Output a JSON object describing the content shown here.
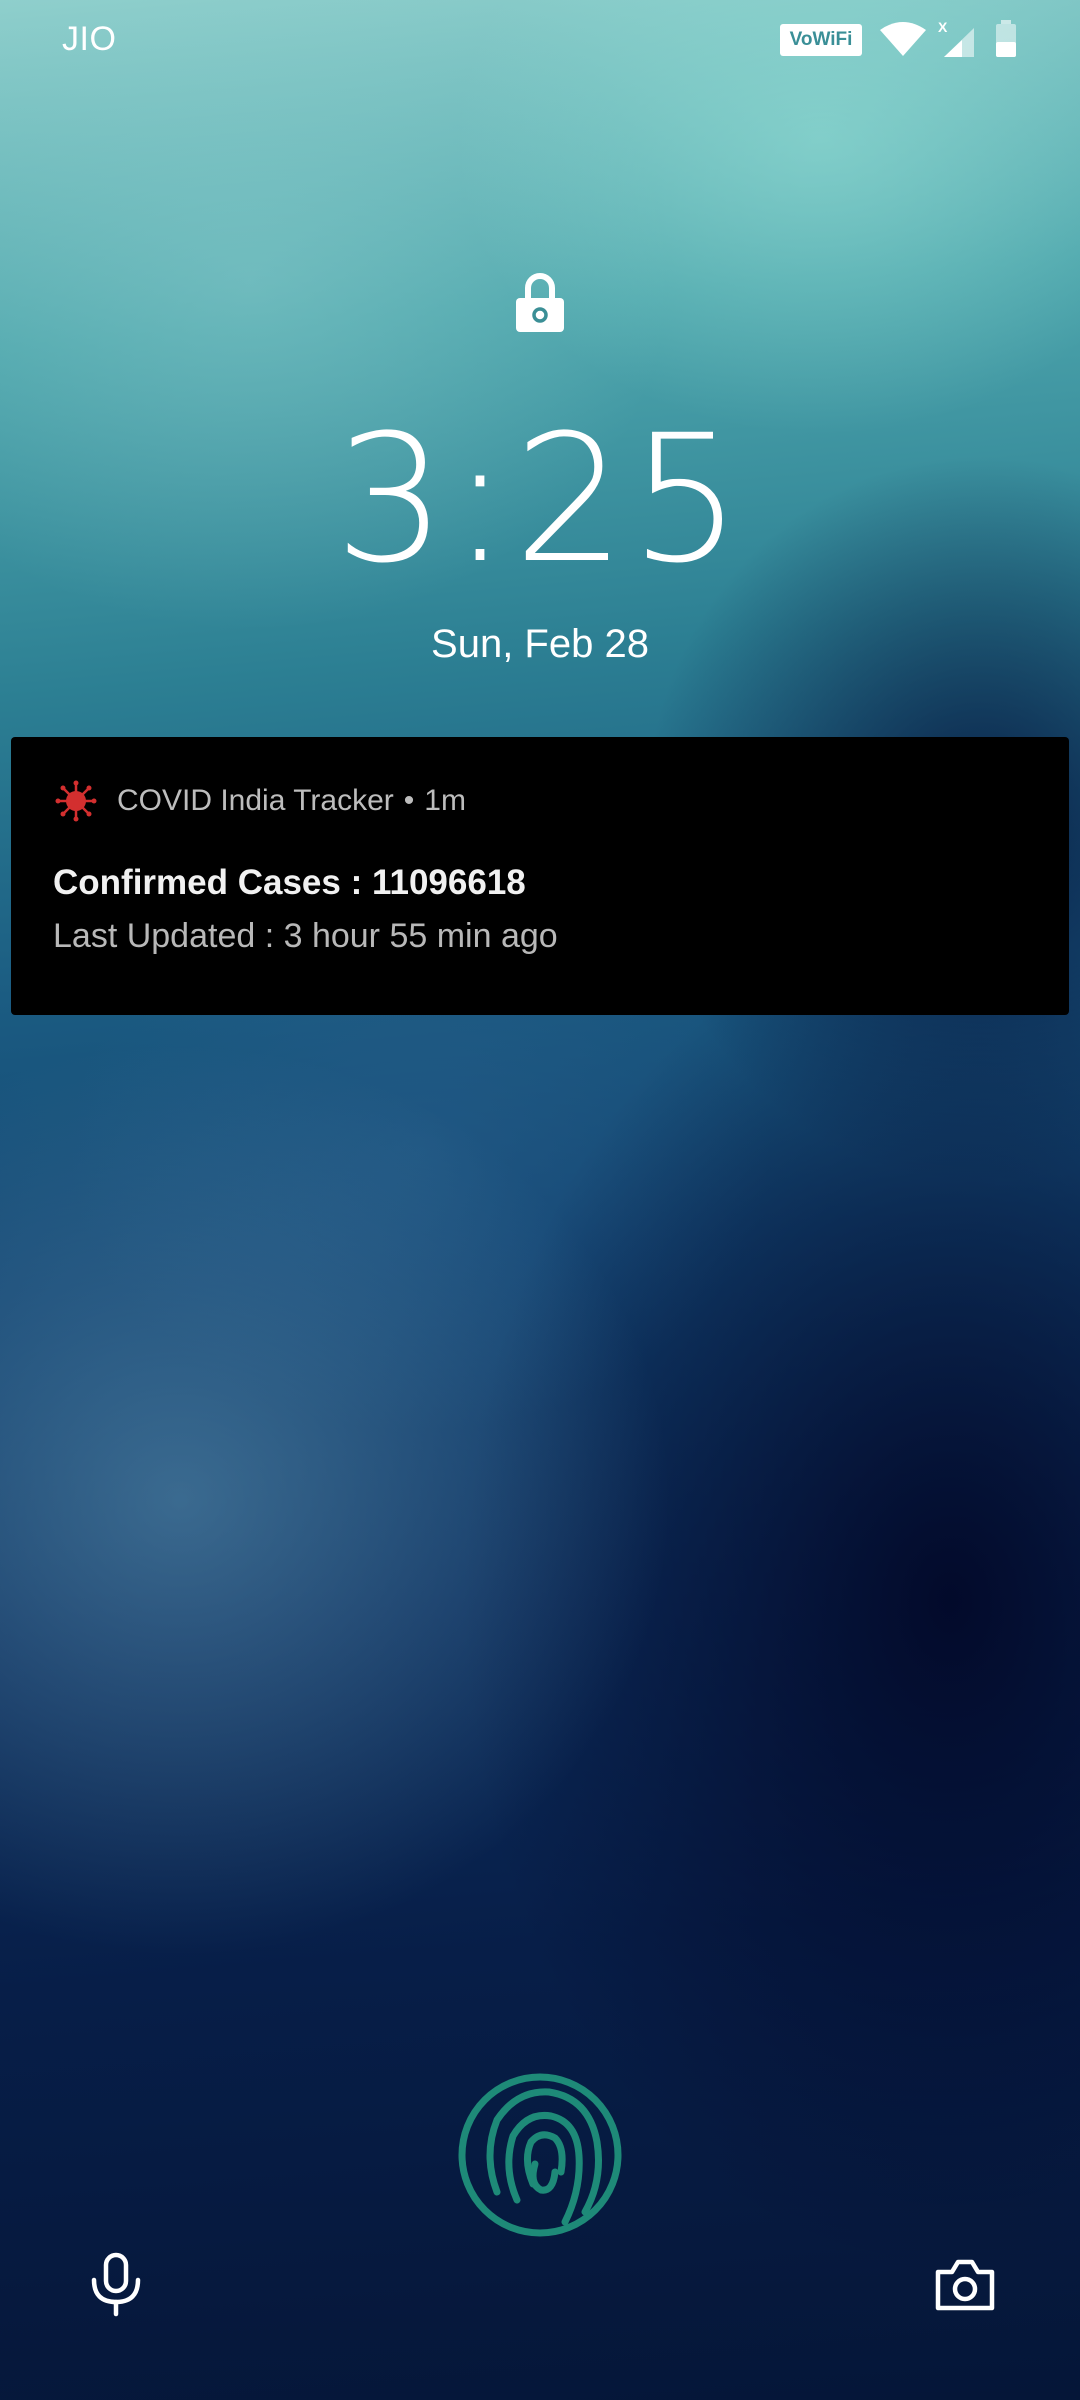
{
  "status_bar": {
    "carrier": "JIO",
    "vowifi_label": "VoWiFi",
    "signal_badge": "X"
  },
  "lockscreen": {
    "time": "3:25",
    "date": "Sun, Feb 28"
  },
  "notification": {
    "app_name": "COVID India Tracker",
    "separator": "•",
    "time_ago": "1m",
    "title": "Confirmed Cases : 11096618",
    "body": "Last Updated : 3 hour 55 min ago",
    "app_icon_color": "#d32f2f"
  },
  "shortcuts": {
    "left": "mic-icon",
    "right": "camera-icon"
  },
  "fingerprint": {
    "icon": "fingerprint-icon",
    "color": "#1e8a78"
  }
}
